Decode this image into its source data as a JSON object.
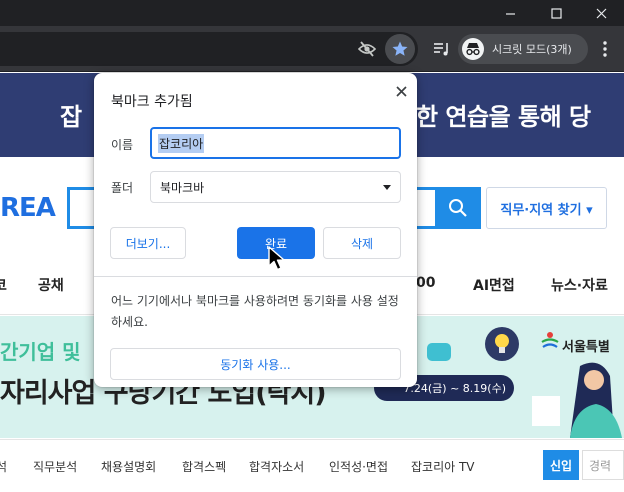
{
  "browser": {
    "window_controls": {
      "minimize": "—",
      "maximize": "☐",
      "close": "✕"
    },
    "toolbar": {
      "icons": [
        "eye-off-icon",
        "star-icon",
        "media-control-icon",
        "incognito-icon",
        "kebab-menu-icon"
      ],
      "incognito_label": "시크릿 모드(3개)"
    }
  },
  "page": {
    "banner_left": "잡",
    "banner_right": "한 연습을 통해 당",
    "logo": "REA",
    "job_search_button": "직무·지역 찾기 ▾",
    "nav": [
      "코",
      "공채",
      "00",
      "AI면접",
      "뉴스·자료"
    ],
    "promo_line1": "간기업 및",
    "promo_line2": "자리사업 구당기간 도입(탁시)",
    "promo_date": "7.24(금) ~ 8.19(수)",
    "promo_seoul": "서울특별",
    "subnav": [
      "석",
      "직무분석",
      "채용설명회",
      "합격스펙",
      "합격자소서",
      "인적성·면접",
      "잡코리아 TV"
    ],
    "subnav_tab_active": "신입",
    "subnav_tab_other": "경력"
  },
  "dialog": {
    "title": "북마크 추가됨",
    "name_label": "이름",
    "name_value": "잡코리아",
    "folder_label": "폴더",
    "folder_value": "북마크바",
    "more_button": "더보기...",
    "done_button": "완료",
    "delete_button": "삭제",
    "sync_message": "어느 기기에서나 북마크를 사용하려면 동기화를 사용 설정하세요.",
    "sync_button": "동기화 사용..."
  },
  "colors": {
    "accent": "#1a73e8",
    "chrome_dark": "#202124",
    "toolbar": "#35363a",
    "banner": "#2f3d73",
    "promo_bg": "#d7f2ee"
  }
}
